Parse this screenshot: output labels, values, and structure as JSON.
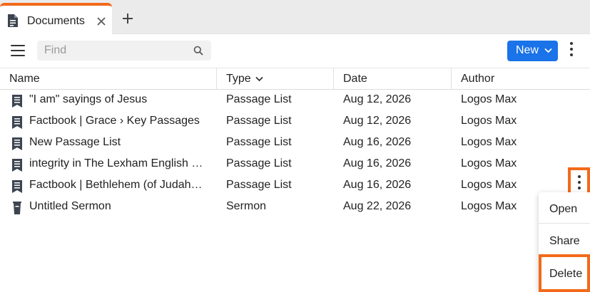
{
  "tab": {
    "label": "Documents",
    "icon": "document-icon"
  },
  "toolbar": {
    "search_placeholder": "Find",
    "new_label": "New"
  },
  "columns": [
    "Name",
    "Type",
    "Date",
    "Author"
  ],
  "rows": [
    {
      "icon": "passage-list-icon",
      "name": "\"I am\" sayings of Jesus",
      "type": "Passage List",
      "date": "Aug 12, 2026",
      "author": "Logos Max"
    },
    {
      "icon": "passage-list-icon",
      "name": "Factbook | Grace › Key Passages",
      "type": "Passage List",
      "date": "Aug 12, 2026",
      "author": "Logos Max"
    },
    {
      "icon": "passage-list-icon",
      "name": "New Passage List",
      "type": "Passage List",
      "date": "Aug 16, 2026",
      "author": "Logos Max"
    },
    {
      "icon": "passage-list-icon",
      "name": "integrity in The Lexham English …",
      "type": "Passage List",
      "date": "Aug 16, 2026",
      "author": "Logos Max"
    },
    {
      "icon": "passage-list-icon",
      "name": "Factbook | Bethlehem (of Judah…",
      "type": "Passage List",
      "date": "Aug 16, 2026",
      "author": "Logos Max"
    },
    {
      "icon": "sermon-icon",
      "name": "Untitled Sermon",
      "type": "Sermon",
      "date": "Aug 22, 2026",
      "author": "Logos Max"
    }
  ],
  "context_menu": {
    "open": "Open",
    "share": "Share",
    "delete": "Delete"
  },
  "colors": {
    "accent": "#f26a1b",
    "primary_button": "#1a73e8"
  }
}
